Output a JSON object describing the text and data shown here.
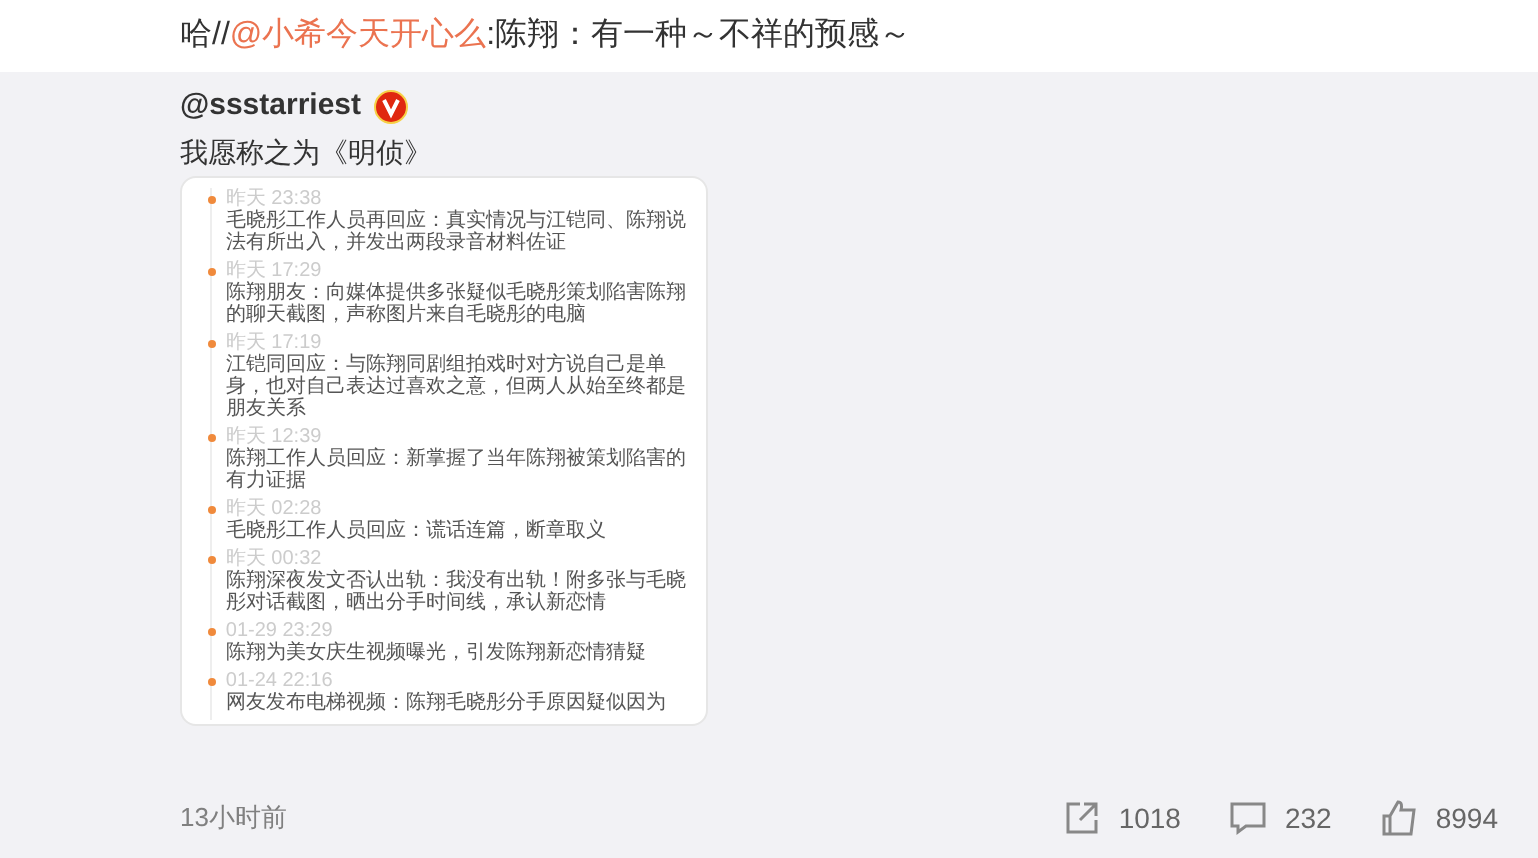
{
  "repost_text": {
    "prefix": "哈//",
    "mention": "@小希今天开心么",
    "body": ":陈翔：有一种～不祥的预感～"
  },
  "original": {
    "author": "@ssstarriest",
    "verified": true,
    "text": "我愿称之为《明侦》",
    "timeline": [
      {
        "time": "昨天 23:38",
        "text": "毛晓彤工作人员再回应：真实情况与江铠同、陈翔说法有所出入，并发出两段录音材料佐证"
      },
      {
        "time": "昨天 17:29",
        "text": "陈翔朋友：向媒体提供多张疑似毛晓彤策划陷害陈翔的聊天截图，声称图片来自毛晓彤的电脑"
      },
      {
        "time": "昨天 17:19",
        "text": "江铠同回应：与陈翔同剧组拍戏时对方说自己是单身，也对自己表达过喜欢之意，但两人从始至终都是朋友关系"
      },
      {
        "time": "昨天 12:39",
        "text": "陈翔工作人员回应：新掌握了当年陈翔被策划陷害的有力证据"
      },
      {
        "time": "昨天 02:28",
        "text": "毛晓彤工作人员回应：谎话连篇，断章取义"
      },
      {
        "time": "昨天 00:32",
        "text": "陈翔深夜发文否认出轨：我没有出轨！附多张与毛晓彤对话截图，晒出分手时间线，承认新恋情"
      },
      {
        "time": "01-29 23:29",
        "text": "陈翔为美女庆生视频曝光，引发陈翔新恋情猜疑"
      },
      {
        "time": "01-24 22:16",
        "text": "网友发布电梯视频：陈翔毛晓彤分手原因疑似因为"
      }
    ]
  },
  "footer": {
    "time": "13小时前",
    "reposts": "1018",
    "comments": "232",
    "likes": "8994"
  }
}
